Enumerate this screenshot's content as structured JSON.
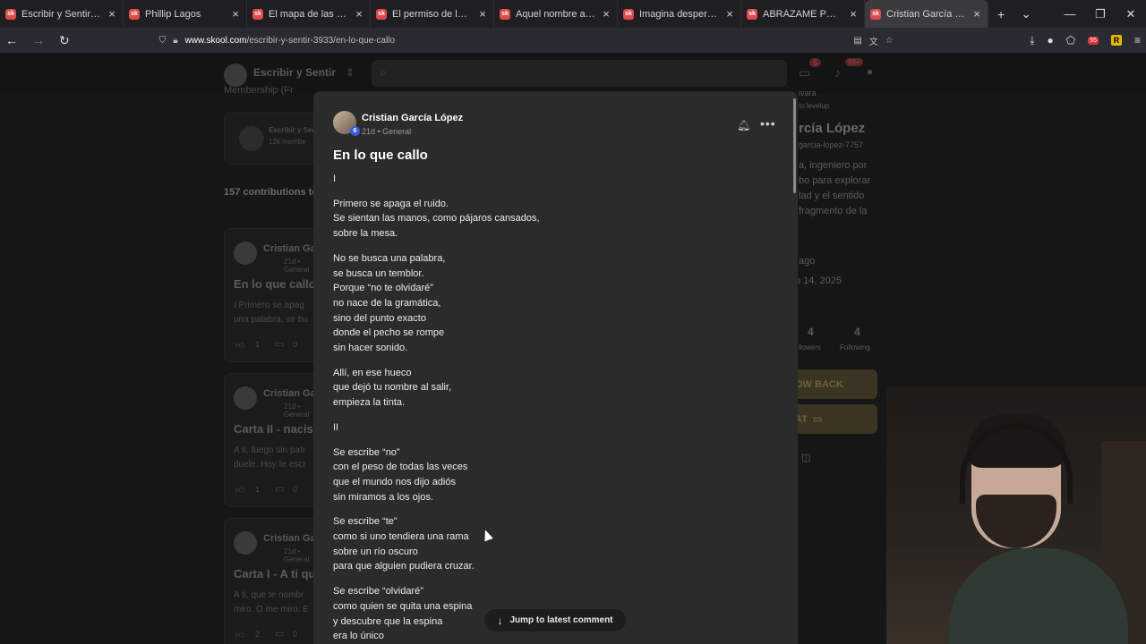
{
  "browser": {
    "tabs": [
      {
        "title": "Escribir y Sentir - General",
        "active": false
      },
      {
        "title": "Phillip Lagos",
        "active": false
      },
      {
        "title": "El mapa de las ausencias |",
        "active": false
      },
      {
        "title": "El permiso de las alas que a",
        "active": false
      },
      {
        "title": "Aquel nombre aún. · Escrib",
        "active": false
      },
      {
        "title": "Imagina despertar · Escribir",
        "active": false
      },
      {
        "title": "ABRÁZAME POR QUÉ ME E",
        "active": false
      },
      {
        "title": "Cristian García López",
        "active": true
      }
    ],
    "favicon_text": "sk",
    "new_tab": "+",
    "url_domain": "www.skool.com",
    "url_path": "/escribir-y-sentir-3933/en-lo-que-callo",
    "ext_badge": "55",
    "ext_r": "R"
  },
  "background": {
    "group_name": "Escribir y Sentir",
    "chat_badge": "6",
    "notif_badge": "99+",
    "membership": "Membership (Fr",
    "group_card_title": "Escribir y Sen",
    "group_card_sub": "12k membe",
    "contributions": "157 contributions to",
    "posts": [
      {
        "author": "Cristian Ga",
        "meta": "21d • General",
        "title": "En lo que callo",
        "excerpt1": "I Primero se apag",
        "excerpt2": "una palabra, se bu",
        "likes": "1",
        "comments": "0"
      },
      {
        "author": "Cristian Ga",
        "meta": "21d • General",
        "title": "Carta II - nacis",
        "excerpt1": "A ti, fuego sin patr",
        "excerpt2": "duele. Hoy te escr",
        "likes": "1",
        "comments": "0"
      },
      {
        "author": "Cristian Ga",
        "meta": "21d • General",
        "title": "Carta I - A ti qu",
        "excerpt1": "A ti, que te nombr",
        "excerpt2": "miro. O me miro. E",
        "likes": "2",
        "comments": "0"
      }
    ],
    "profile": {
      "top": "ivara",
      "link": "to levelup",
      "name": "rcía López",
      "handle": "garcia-lopez-7757",
      "bio1": "a, ingeniero por",
      "bio2": "bo para explorar",
      "bio3": "lad y el sentido",
      "bio4": "fragmento de la",
      "joined_label": "ago",
      "joined_date": "p 14, 2025",
      "followers_count": "4",
      "following_count": "4",
      "followers_label": "llowers",
      "following_label": "Following",
      "follow_back": "OW BACK",
      "chat": "AT"
    }
  },
  "post": {
    "author": "Cristian García López",
    "level": "6",
    "meta": "21d • General",
    "title": "En lo que callo",
    "stanzas": [
      [
        "I"
      ],
      [
        "Primero se apaga el ruido.",
        "Se sientan las manos, como pájaros cansados,",
        "sobre la mesa."
      ],
      [
        "No se busca una palabra,",
        "se busca un temblor.",
        "Porque “no te olvidaré”",
        "no nace de la gramática,",
        "sino del punto exacto",
        "donde el pecho se rompe",
        "sin hacer sonido."
      ],
      [
        "Allí, en ese hueco",
        "que dejó tu nombre al salir,",
        "empieza la tinta."
      ],
      [
        "II"
      ],
      [
        "Se escribe “no”",
        "con el peso de todas las veces",
        "que el mundo nos dijo adiós",
        "sin miramos a los ojos."
      ],
      [
        "Se escribe “te”",
        "como si uno tendiera una rama",
        "sobre un río oscuro",
        "para que alguien pudiera cruzar."
      ],
      [
        "Se escribe “olvidaré”",
        "como quien se quita una espina",
        "y descubre que la espina",
        "era lo único"
      ]
    ],
    "jump_label": "Jump to latest comment"
  },
  "icons": {
    "bell": "bell-icon",
    "more": "more-icon",
    "arrow_down": "arrow-down-icon"
  }
}
